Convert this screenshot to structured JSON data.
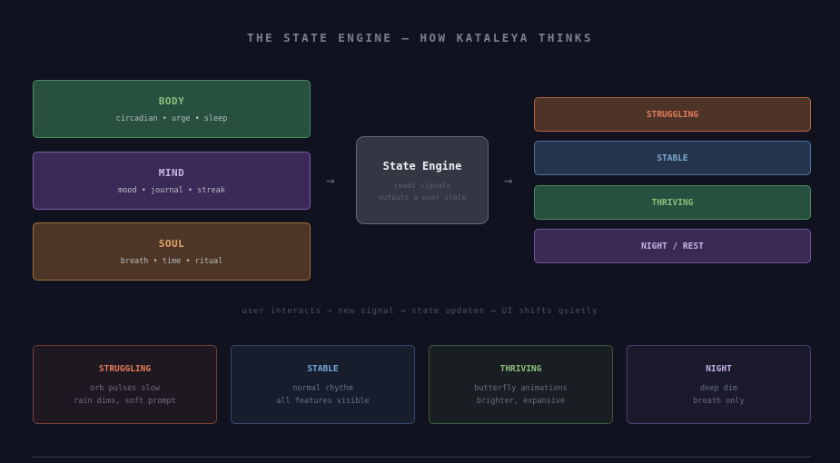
{
  "title": "THE STATE ENGINE — HOW KATALEYA THINKS",
  "sources": [
    {
      "label": "BODY",
      "detail": "circadian • urge • sleep",
      "color": "#8fbf7f",
      "bg": "#27503f",
      "border": "#4d8a63"
    },
    {
      "label": "MIND",
      "detail": "mood • journal • streak",
      "color": "#c9b2e6",
      "bg": "#3b2a57",
      "border": "#7a5fa6"
    },
    {
      "label": "SOUL",
      "detail": "breath • time • ritual",
      "color": "#e3a56b",
      "bg": "#4d3625",
      "border": "#a0703f"
    }
  ],
  "arrow": "→",
  "engine": {
    "title": "State Engine",
    "line1": "reads signals",
    "line2": "outputs a user state"
  },
  "states": [
    {
      "label": "STRUGGLING",
      "color": "#e37c5c",
      "bg": "#4d3426",
      "border": "#b9623f"
    },
    {
      "label": "STABLE",
      "color": "#7aaad6",
      "bg": "#25344a",
      "border": "#4c739e"
    },
    {
      "label": "THRIVING",
      "color": "#8fbf7f",
      "bg": "#27503f",
      "border": "#4d8a63"
    },
    {
      "label": "NIGHT / REST",
      "color": "#c9b2e6",
      "bg": "#3a2952",
      "border": "#6f5699"
    }
  ],
  "caption": "user interacts → new signal → state updates → UI shifts quietly",
  "cards": [
    {
      "label": "STRUGGLING",
      "line1": "orb pulses slow",
      "line2": "rain dims, soft prompt",
      "color": "#e37c5c",
      "bg": "#1f1820",
      "border": "#7a3f36"
    },
    {
      "label": "STABLE",
      "line1": "normal rhythm",
      "line2": "all features visible",
      "color": "#7aaad6",
      "bg": "#161e2e",
      "border": "#34496a"
    },
    {
      "label": "THRIVING",
      "line1": "butterfly animations",
      "line2": "brighter, expansive",
      "color": "#8fbf7f",
      "bg": "#181e22",
      "border": "#3d5a40"
    },
    {
      "label": "NIGHT",
      "line1": "deep dim",
      "line2": "breath only",
      "color": "#c9b2e6",
      "bg": "#1a1a2c",
      "border": "#4a4270"
    }
  ]
}
